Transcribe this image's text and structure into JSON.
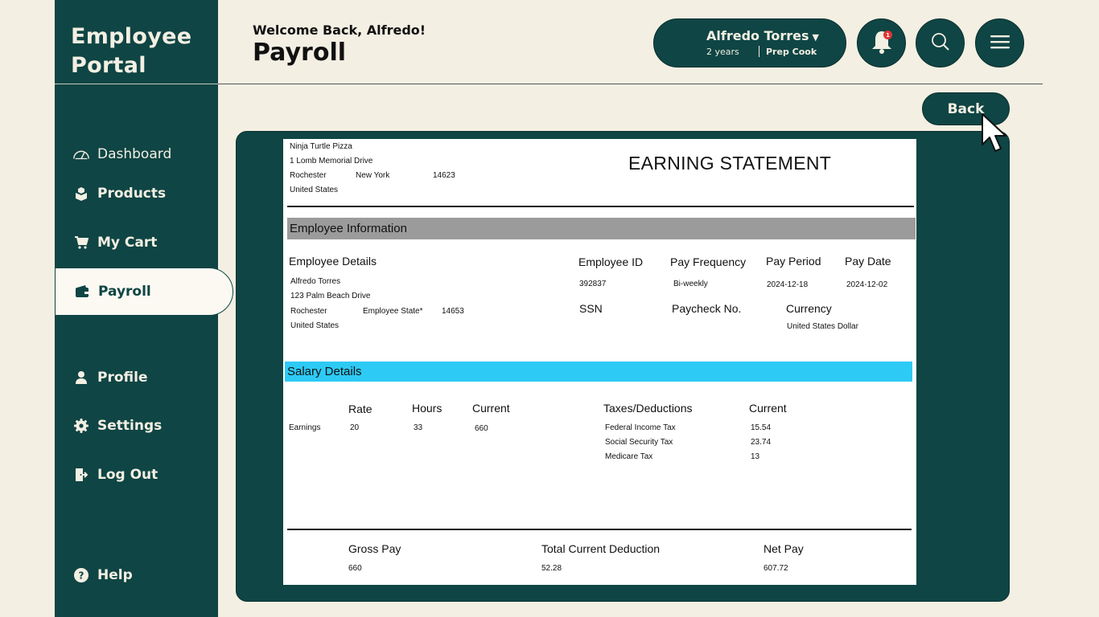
{
  "app": {
    "logo_line1": "Employee",
    "logo_line2": "Portal"
  },
  "nav": {
    "dashboard": "Dashboard",
    "products": "Products",
    "cart": "My Cart",
    "payroll": "Payroll",
    "profile": "Profile",
    "settings": "Settings",
    "logout": "Log Out",
    "help": "Help"
  },
  "header": {
    "welcome": "Welcome Back, Alfredo!",
    "title": "Payroll",
    "user_name": "Alfredo Torres",
    "user_years": "2 years",
    "user_role": "Prep Cook",
    "notification_count": "1"
  },
  "back_label": "Back",
  "statement": {
    "title": "EARNING STATEMENT",
    "company": {
      "name": "Ninja Turtle Pizza",
      "street": "1 Lomb Memorial Drive",
      "city": "Rochester",
      "state": "New York",
      "zip": "14623",
      "country": "United States"
    },
    "employee_info_heading": "Employee Information",
    "employee_details_label": "Employee Details",
    "employee": {
      "name": "Alfredo Torres",
      "street": "123 Palm Beach Drive",
      "city": "Rochester",
      "state": "Employee State*",
      "zip": "14653",
      "country": "United States"
    },
    "labels": {
      "employee_id": "Employee ID",
      "pay_frequency": "Pay Frequency",
      "pay_period": "Pay Period",
      "pay_date": "Pay Date",
      "ssn": "SSN",
      "paycheck_no": "Paycheck No.",
      "currency": "Currency"
    },
    "values": {
      "employee_id": "392837",
      "pay_frequency": "Bi-weekly",
      "pay_period": "2024-12-18",
      "pay_date": "2024-12-02",
      "currency": "United States Dollar"
    },
    "salary_heading": "Salary Details",
    "earnings": {
      "col_rate": "Rate",
      "col_hours": "Hours",
      "col_current": "Current",
      "row_label": "Earnings",
      "rate": "20",
      "hours": "33",
      "current": "660"
    },
    "deductions": {
      "col_taxes": "Taxes/Deductions",
      "col_current": "Current",
      "items": [
        {
          "name": "Federal Income Tax",
          "amount": "15.54"
        },
        {
          "name": "Social Security Tax",
          "amount": "23.74"
        },
        {
          "name": "Medicare Tax",
          "amount": "13"
        }
      ]
    },
    "totals": {
      "gross_label": "Gross Pay",
      "gross": "660",
      "deduction_label": "Total Current Deduction",
      "deduction": "52.28",
      "net_label": "Net Pay",
      "net": "607.72"
    }
  },
  "colors": {
    "primary": "#0f4544",
    "background": "#f3efe3",
    "band_gray": "#9b9b9b",
    "band_blue": "#2dcaf5",
    "badge": "#e23434"
  }
}
